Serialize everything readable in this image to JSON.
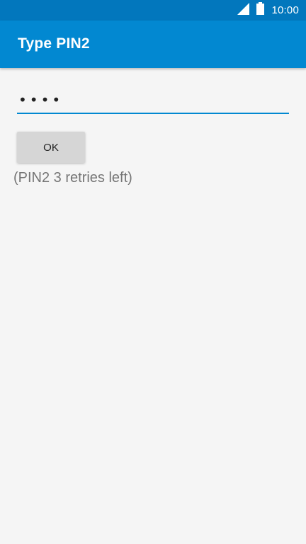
{
  "status_bar": {
    "time": "10:00",
    "icons": [
      "signal-icon",
      "battery-icon"
    ]
  },
  "app_bar": {
    "title": "Type PIN2"
  },
  "pin_input": {
    "value": "••••"
  },
  "ok_button": {
    "label": "OK"
  },
  "retries_message": "(PIN2 3 retries left)",
  "colors": {
    "status_bar": "#0277bd",
    "app_bar": "#0288d1",
    "accent": "#0288d1",
    "background": "#f5f5f5"
  }
}
